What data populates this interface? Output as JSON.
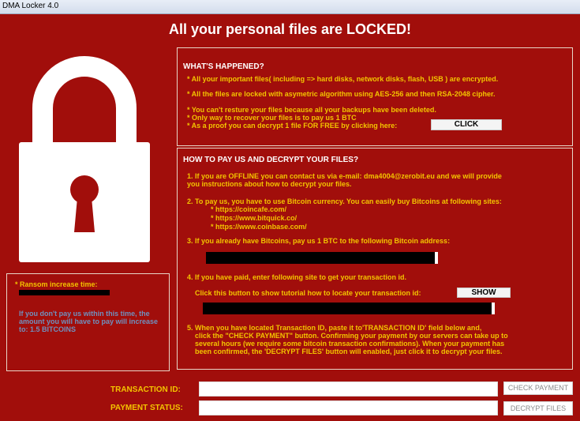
{
  "window": {
    "title": "DMA Locker 4.0"
  },
  "headline": "All your personal files are LOCKED!",
  "what": {
    "title": "WHAT'S HAPPENED?",
    "lines": [
      "* All your important files( including => hard disks, network disks, flash, USB ) are encrypted.",
      "* All the files are locked with asymetric algorithm using AES-256 and then RSA-2048 cipher.",
      "* You can't resture your files because all your backups have been deleted.",
      "* Only way to recover your files is to pay us  1 BTC",
      "* As a proof you can decrypt 1 file FOR FREE by clicking here:"
    ],
    "click_label": "CLICK"
  },
  "how": {
    "title": "HOW TO PAY US AND DECRYPT YOUR FILES?",
    "step1_a": "1. If you are OFFLINE you can contact us via e-mail: dma4004@zerobit.eu and we will provide",
    "step1_b": "you instructions about how to decrypt your files.",
    "step2": "2. To pay us, you have to use  Bitcoin   currency. You can easily buy Bitcoins at following sites:",
    "sites": [
      "* https://coincafe.com/",
      "* https://www.bitquick.co/",
      "* https://www.coinbase.com/"
    ],
    "step3": "3. If you already have Bitcoins, pay us    1 BTC        to the following Bitcoin address:",
    "step4": "4. If you have paid, enter following site to get your transaction id.",
    "step4_click": "Click this button to show tutorial how to locate your transaction id:",
    "show_label": "SHOW",
    "step5_lines": [
      "5. When you have located Transaction ID, paste it to'TRANSACTION ID' field below and,",
      "click the     \"CHECK PAYMENT\"   button. Confirming your payment by our servers can take up to",
      "several hours (we require some bitcoin transaction confirmations). When your payment has",
      "been confirmed, the 'DECRYPT FILES' button will enabled, just click it to decrypt your files."
    ]
  },
  "timer": {
    "title": "Ransom increase time:",
    "text": "If you don't pay us within this time, the amount you will have to pay will increase to:  1.5 BITCOINS"
  },
  "bottom": {
    "transaction_label": "TRANSACTION ID:",
    "status_label": "PAYMENT STATUS:",
    "check_payment": "CHECK PAYMENT",
    "decrypt_files": "DECRYPT FILES"
  }
}
